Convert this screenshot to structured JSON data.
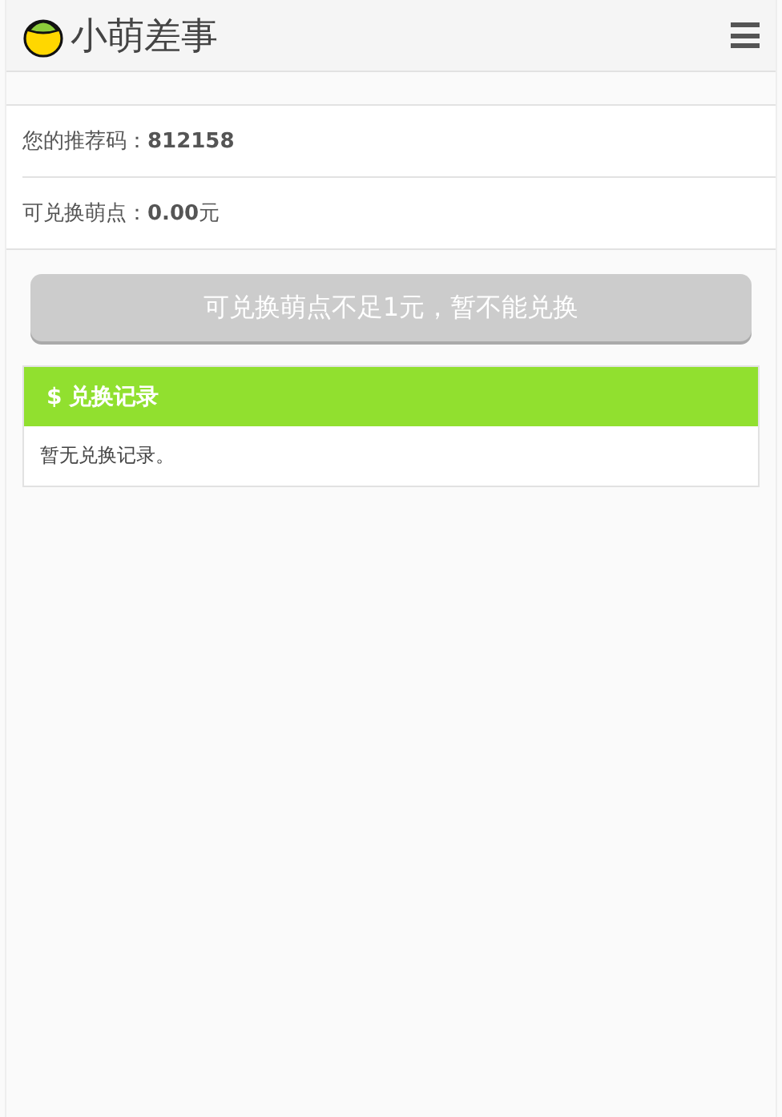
{
  "header": {
    "title": "小萌差事"
  },
  "info_rows": [
    {
      "label": "您的推荐码：",
      "value": "812158",
      "unit": ""
    },
    {
      "label": "可兑换萌点：",
      "value": "0.00",
      "unit": "元"
    }
  ],
  "exchange_button": {
    "label": "可兑换萌点不足1元，暂不能兑换",
    "disabled": true
  },
  "records_panel": {
    "icon": "$",
    "title": "兑换记录",
    "empty_text": "暂无兑换记录。"
  }
}
